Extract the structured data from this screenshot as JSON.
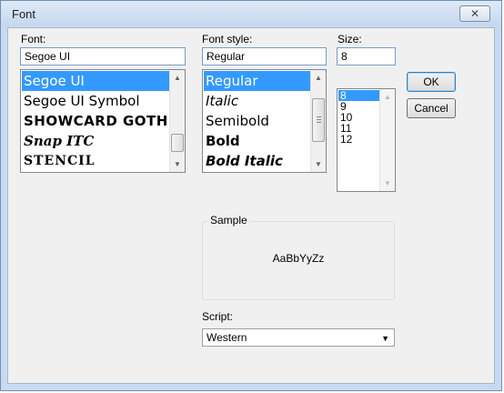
{
  "window": {
    "title": "Font",
    "close_glyph": "✕"
  },
  "font": {
    "label": "Font:",
    "value": "Segoe UI",
    "items": [
      {
        "label": "Segoe UI",
        "selected": true
      },
      {
        "label": "Segoe UI Symbol"
      },
      {
        "label": "SHOWCARD GOTHIC"
      },
      {
        "label": "Snap ITC"
      },
      {
        "label": "STENCIL"
      }
    ]
  },
  "style": {
    "label": "Font style:",
    "value": "Regular",
    "items": [
      {
        "label": "Regular",
        "selected": true
      },
      {
        "label": "Italic"
      },
      {
        "label": "Semibold"
      },
      {
        "label": "Bold"
      },
      {
        "label": "Bold Italic"
      }
    ]
  },
  "size": {
    "label": "Size:",
    "value": "8",
    "items": [
      "8",
      "9",
      "10",
      "11",
      "12"
    ]
  },
  "buttons": {
    "ok": "OK",
    "cancel": "Cancel"
  },
  "sample": {
    "label": "Sample",
    "text": "AaBbYyZz"
  },
  "script": {
    "label": "Script:",
    "value": "Western"
  },
  "icons": {
    "scroll_up": "up-arrow-icon",
    "scroll_down": "down-arrow-icon",
    "dropdown": "chevron-down-icon"
  }
}
